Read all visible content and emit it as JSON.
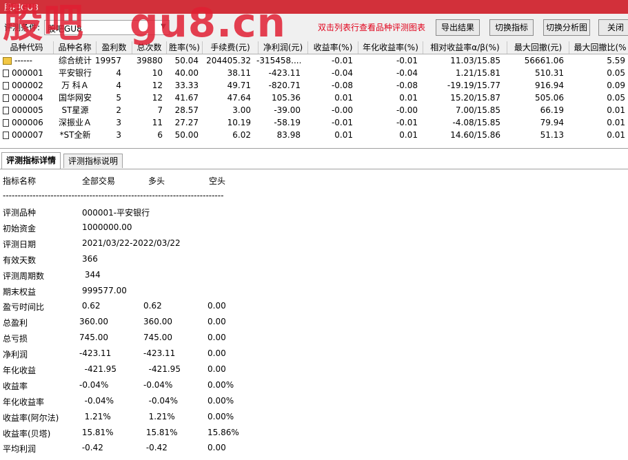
{
  "window": {
    "title": "股吧GU8"
  },
  "watermark": {
    "part1": "股吧",
    "part2": "gu8.cn"
  },
  "toolbar": {
    "condition_label": "评测条件:",
    "condition_value": "股吧GU8",
    "hint": "双击列表行查看品种评测图表",
    "export_label": "导出结果",
    "switch_indicator_label": "切换指标",
    "switch_chart_label": "切换分析图",
    "close_label": "关闭"
  },
  "grid": {
    "columns": [
      "品种代码",
      "品种名称",
      "盈利数",
      "总次数",
      "胜率(%)",
      "手续费(元)",
      "净利润(元)",
      "收益率(%)",
      "年化收益率(%)",
      "相对收益率α/β(%)",
      "最大回撤(元)",
      "最大回撤比(%"
    ],
    "rows": [
      {
        "icon": "summary-icon",
        "code": "------",
        "name": "综合统计",
        "wins": "19957",
        "total": "39880",
        "winrate": "50.04",
        "fee": "204405.32",
        "profit": "-315458....",
        "ret": "-0.01",
        "annual": "-0.01",
        "rel": "11.03/15.85",
        "maxdd": "56661.06",
        "maxddpct": "5.59"
      },
      {
        "icon": "row-icon",
        "code": "000001",
        "name": "平安银行",
        "wins": "4",
        "total": "10",
        "winrate": "40.00",
        "fee": "38.11",
        "profit": "-423.11",
        "ret": "-0.04",
        "annual": "-0.04",
        "rel": "1.21/15.81",
        "maxdd": "510.31",
        "maxddpct": "0.05"
      },
      {
        "icon": "row-icon",
        "code": "000002",
        "name": "万 科Ａ",
        "wins": "4",
        "total": "12",
        "winrate": "33.33",
        "fee": "49.71",
        "profit": "-820.71",
        "ret": "-0.08",
        "annual": "-0.08",
        "rel": "-19.19/15.77",
        "maxdd": "916.94",
        "maxddpct": "0.09"
      },
      {
        "icon": "row-icon",
        "code": "000004",
        "name": "国华网安",
        "wins": "5",
        "total": "12",
        "winrate": "41.67",
        "fee": "47.64",
        "profit": "105.36",
        "ret": "0.01",
        "annual": "0.01",
        "rel": "15.20/15.87",
        "maxdd": "505.06",
        "maxddpct": "0.05"
      },
      {
        "icon": "row-icon",
        "code": "000005",
        "name": "ST星源",
        "wins": "2",
        "total": "7",
        "winrate": "28.57",
        "fee": "3.00",
        "profit": "-39.00",
        "ret": "-0.00",
        "annual": "-0.00",
        "rel": "7.00/15.85",
        "maxdd": "66.19",
        "maxddpct": "0.01"
      },
      {
        "icon": "row-icon",
        "code": "000006",
        "name": "深振业Ａ",
        "wins": "3",
        "total": "11",
        "winrate": "27.27",
        "fee": "10.19",
        "profit": "-58.19",
        "ret": "-0.01",
        "annual": "-0.01",
        "rel": "-4.08/15.85",
        "maxdd": "79.94",
        "maxddpct": "0.01"
      },
      {
        "icon": "row-icon",
        "code": "000007",
        "name": "*ST全新",
        "wins": "3",
        "total": "6",
        "winrate": "50.00",
        "fee": "6.02",
        "profit": "83.98",
        "ret": "0.01",
        "annual": "0.01",
        "rel": "14.60/15.86",
        "maxdd": "51.13",
        "maxddpct": "0.01"
      }
    ]
  },
  "tabs": [
    {
      "label": "评测指标详情"
    },
    {
      "label": "评测指标说明"
    }
  ],
  "detail": {
    "header": {
      "name": "指标名称",
      "all": "全部交易",
      "long": "多头",
      "short": "空头"
    },
    "separator": "--------------------------------------------------------------------------",
    "info": [
      {
        "label": "评测品种",
        "value": "000001-平安银行"
      },
      {
        "label": "初始资金",
        "value": "1000000.00"
      },
      {
        "label": "评测日期",
        "value": "2021/03/22-2022/03/22"
      },
      {
        "label": "有效天数",
        "value": "366"
      },
      {
        "label": "评测周期数",
        "value": " 344"
      },
      {
        "label": "期末权益",
        "value": "999577.00"
      }
    ],
    "metrics": [
      {
        "label": "盈亏时间比",
        "all": " 0.62",
        "long": "0.62",
        "short": "0.00"
      },
      {
        "label": "总盈利",
        "all": "360.00",
        "long": "360.00",
        "short": "0.00"
      },
      {
        "label": "总亏损",
        "all": "745.00",
        "long": "745.00",
        "short": "0.00"
      },
      {
        "label": "净利润",
        "all": "-423.11",
        "long": "-423.11",
        "short": "0.00"
      },
      {
        "label": "年化收益",
        "all": "  -421.95",
        "long": "  -421.95",
        "short": "0.00"
      },
      {
        "label": "收益率",
        "all": "-0.04%",
        "long": "-0.04%",
        "short": "0.00%"
      },
      {
        "label": "年化收益率",
        "all": "  -0.04%",
        "long": "  -0.04%",
        "short": "0.00%"
      },
      {
        "label": "收益率(阿尔法)",
        "all": "  1.21%",
        "long": "  1.21%",
        "short": "0.00%"
      },
      {
        "label": "收益率(贝塔)",
        "all": " 15.81%",
        "long": " 15.81%",
        "short": "15.86%"
      },
      {
        "label": "平均利润",
        "all": " -0.42",
        "long": " -0.42",
        "short": "0.00"
      }
    ]
  }
}
